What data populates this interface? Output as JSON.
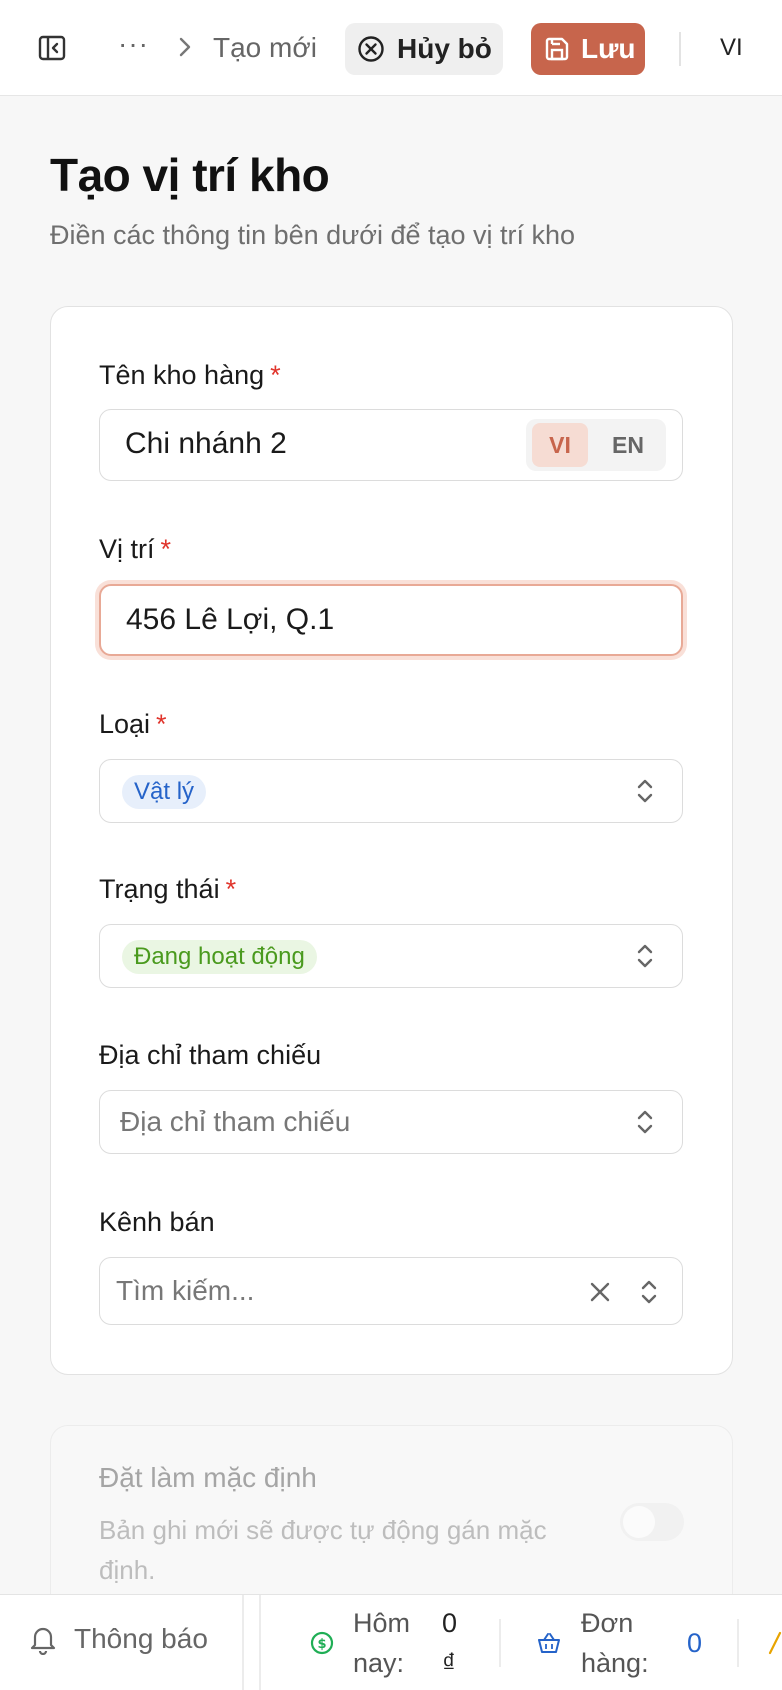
{
  "topbar": {
    "breadcrumb_more": "···",
    "breadcrumb_current": "Tạo mới",
    "cancel_label": "Hủy bỏ",
    "save_label": "Lưu",
    "language": "VI"
  },
  "page": {
    "title": "Tạo vị trí kho",
    "subtitle": "Điền các thông tin bên dưới để tạo vị trí kho"
  },
  "form": {
    "warehouse_name": {
      "label": "Tên kho hàng",
      "required_mark": "*",
      "value": "Chi nhánh 2",
      "lang_options": [
        "VI",
        "EN"
      ],
      "active_lang": "VI"
    },
    "location": {
      "label": "Vị trí",
      "required_mark": "*",
      "value": "456 Lê Lợi, Q.1"
    },
    "type": {
      "label": "Loại",
      "required_mark": "*",
      "value": "Vật lý",
      "badge_color": "#2563c9"
    },
    "status": {
      "label": "Trạng thái",
      "required_mark": "*",
      "value": "Đang hoạt động",
      "badge_color": "#4a9a1e"
    },
    "reference_address": {
      "label": "Địa chỉ tham chiếu",
      "placeholder": "Địa chỉ tham chiếu"
    },
    "sales_channel": {
      "label": "Kênh bán",
      "placeholder": "Tìm kiếm..."
    }
  },
  "default_section": {
    "title": "Đặt làm mặc định",
    "description": "Bản ghi mới sẽ được tự động gán mặc định.",
    "enabled": false
  },
  "bottombar": {
    "notifications_label": "Thông báo",
    "today_label": "Hôm nay:",
    "today_value": "0 ₫",
    "orders_label": "Đơn hàng:",
    "orders_value": "0"
  },
  "colors": {
    "accent": "#c7654c",
    "required": "#e0342b",
    "orders_value": "#2563c9"
  }
}
